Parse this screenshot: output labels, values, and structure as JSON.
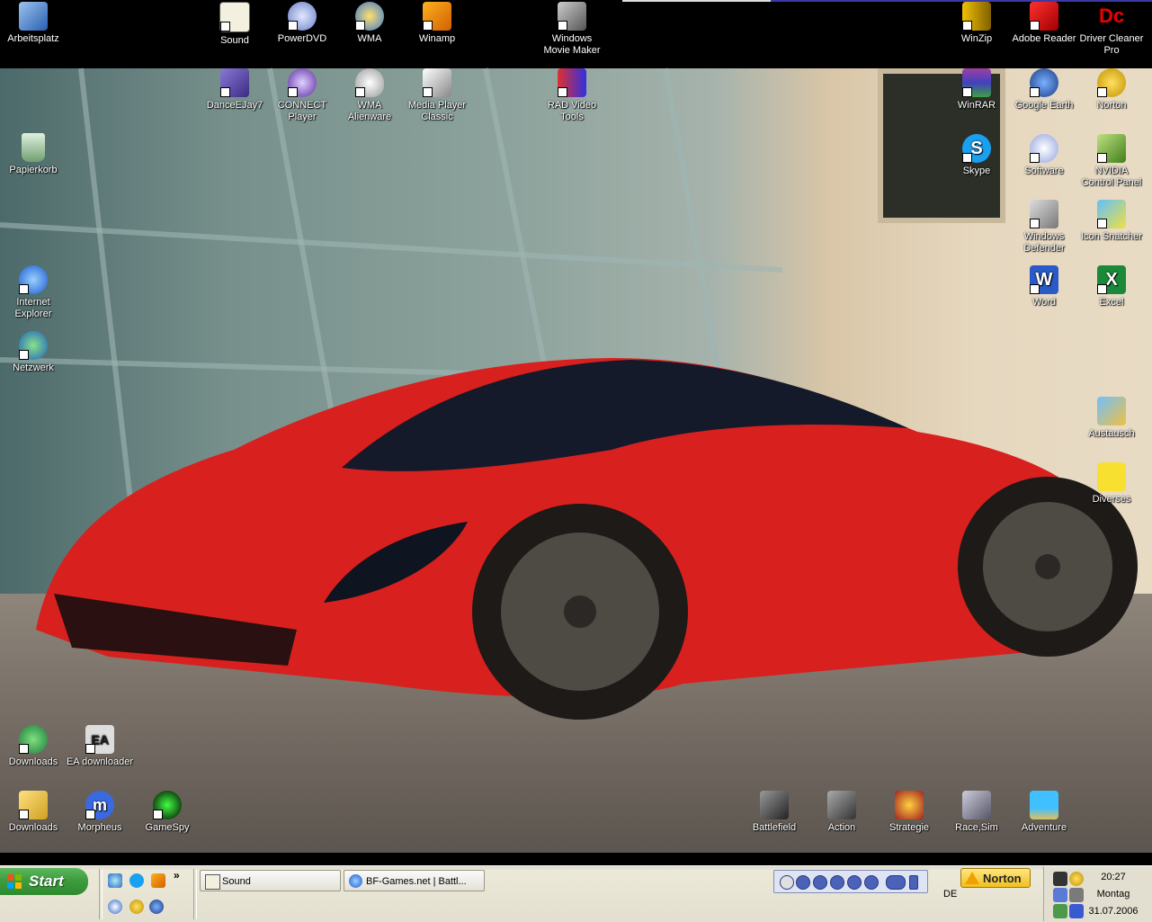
{
  "desktop": {
    "icons_top_row": [
      {
        "label": "Arbeitsplatz",
        "icon": "my-computer-icon"
      },
      {
        "label": "Sound",
        "icon": "sound-folder-icon"
      },
      {
        "label": "PowerDVD",
        "icon": "powerdvd-icon"
      },
      {
        "label": "WMA",
        "icon": "wma-icon"
      },
      {
        "label": "Winamp",
        "icon": "winamp-icon"
      },
      {
        "label": "Windows Movie Maker",
        "icon": "movie-maker-icon"
      },
      {
        "label": "WinZip",
        "icon": "winzip-icon"
      },
      {
        "label": "Adobe Reader",
        "icon": "adobe-reader-icon"
      },
      {
        "label": "Driver Cleaner Pro",
        "icon": "driver-cleaner-icon"
      }
    ],
    "icons_second_row": [
      {
        "label": "DanceEJay7",
        "icon": "dance-ejay-icon"
      },
      {
        "label": "CONNECT Player",
        "icon": "connect-player-icon"
      },
      {
        "label": "WMA Alienware",
        "icon": "alienware-icon"
      },
      {
        "label": "Media Player Classic",
        "icon": "media-player-classic-icon"
      },
      {
        "label": "RAD Video Tools",
        "icon": "rad-video-tools-icon"
      },
      {
        "label": "WinRAR",
        "icon": "winrar-icon"
      },
      {
        "label": "Google Earth",
        "icon": "google-earth-icon"
      },
      {
        "label": "Norton",
        "icon": "norton-icon"
      }
    ],
    "icons_left": [
      {
        "label": "Papierkorb",
        "icon": "recycle-bin-icon"
      },
      {
        "label": "Internet Explorer",
        "icon": "internet-explorer-icon"
      },
      {
        "label": "Netzwerk",
        "icon": "network-icon"
      }
    ],
    "icons_right": [
      {
        "label": "Skype",
        "icon": "skype-icon"
      },
      {
        "label": "Software",
        "icon": "software-cd-icon"
      },
      {
        "label": "NVIDIA Control Panel",
        "icon": "nvidia-icon"
      },
      {
        "label": "Windows Defender",
        "icon": "windows-defender-icon"
      },
      {
        "label": "Icon Snatcher",
        "icon": "icon-snatcher-icon"
      },
      {
        "label": "Word",
        "icon": "word-icon"
      },
      {
        "label": "Excel",
        "icon": "excel-icon"
      },
      {
        "label": "Austausch",
        "icon": "exchange-folder-icon"
      },
      {
        "label": "Diverses",
        "icon": "bart-folder-icon"
      }
    ],
    "icons_bottom": [
      {
        "label": "Downloads",
        "icon": "downloads-globe-icon"
      },
      {
        "label": "EA downloader",
        "icon": "ea-downloader-icon"
      },
      {
        "label": "Downloads",
        "icon": "downloads-folder-icon"
      },
      {
        "label": "Morpheus",
        "icon": "morpheus-icon"
      },
      {
        "label": "GameSpy",
        "icon": "gamespy-icon"
      },
      {
        "label": "Battlefield",
        "icon": "battlefield-folder-icon"
      },
      {
        "label": "Action",
        "icon": "action-folder-icon"
      },
      {
        "label": "Strategie",
        "icon": "strategy-folder-icon"
      },
      {
        "label": "Race,Sim",
        "icon": "race-sim-folder-icon"
      },
      {
        "label": "Adventure",
        "icon": "adventure-folder-icon"
      }
    ]
  },
  "taskbar": {
    "start_label": "Start",
    "tasks": [
      {
        "label": "Sound",
        "icon": "folder-icon"
      },
      {
        "label": "BF-Games.net | Battl...",
        "icon": "ie-icon"
      }
    ],
    "quicklaunch_more": "»",
    "norton_label": "Norton",
    "language": "DE",
    "clock": {
      "time": "20:27",
      "day": "Montag",
      "date": "31.07.2006"
    }
  },
  "colors": {
    "taskbar": "#ECE9D8",
    "start_green": "#3E9B3E",
    "car_red": "#D8201E"
  }
}
